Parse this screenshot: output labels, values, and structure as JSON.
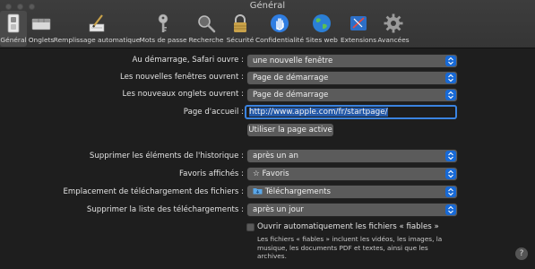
{
  "window": {
    "title": "Général"
  },
  "toolbar": {
    "items": [
      {
        "label": "Général",
        "icon": "general-switch-icon",
        "active": true
      },
      {
        "label": "Onglets",
        "icon": "tabs-icon"
      },
      {
        "label": "Remplissage automatique",
        "icon": "pencil-form-icon"
      },
      {
        "label": "Mots de passe",
        "icon": "key-icon"
      },
      {
        "label": "Recherche",
        "icon": "magnifier-icon"
      },
      {
        "label": "Sécurité",
        "icon": "lock-icon"
      },
      {
        "label": "Confidentialité",
        "icon": "hand-icon"
      },
      {
        "label": "Sites web",
        "icon": "globe-icon"
      },
      {
        "label": "Extensions",
        "icon": "extensions-icon"
      },
      {
        "label": "Avancées",
        "icon": "gear-icon"
      }
    ]
  },
  "form": {
    "startup": {
      "label": "Au démarrage, Safari ouvre :",
      "value": "une nouvelle fenêtre"
    },
    "new_windows": {
      "label": "Les nouvelles fenêtres ouvrent :",
      "value": "Page de démarrage"
    },
    "new_tabs": {
      "label": "Les nouveaux onglets ouvrent :",
      "value": "Page de démarrage"
    },
    "homepage": {
      "label": "Page d'accueil :",
      "value": "http://www.apple.com/fr/startpage/"
    },
    "use_current_button": "Utiliser la page active",
    "history": {
      "label": "Supprimer les éléments de l'historique :",
      "value": "après un an"
    },
    "favorites": {
      "label": "Favoris affichés :",
      "value": "Favoris",
      "glyph": "☆"
    },
    "download_location": {
      "label": "Emplacement de téléchargement des fichiers :",
      "value": "Téléchargements"
    },
    "download_list": {
      "label": "Supprimer la liste des téléchargements :",
      "value": "après un jour"
    },
    "safe_files": {
      "label": "Ouvrir automatiquement les fichiers « fiables »",
      "checked": false,
      "help_text": "Les fichiers « fiables » incluent les vidéos, les images, la musique, les documents PDF et textes, ainsi que les archives."
    }
  },
  "help_button": "?"
}
